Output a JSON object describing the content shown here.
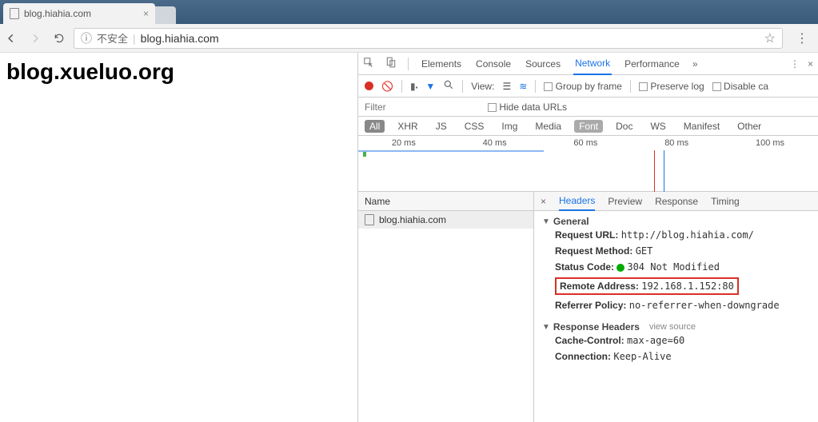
{
  "browser": {
    "tab_title": "blog.hiahia.com",
    "insecure_label": "不安全",
    "url_display": "blog.hiahia.com"
  },
  "page": {
    "heading": "blog.xueluo.org"
  },
  "devtools": {
    "tabs": [
      "Elements",
      "Console",
      "Sources",
      "Network",
      "Performance"
    ],
    "active_tab": "Network",
    "toolbar": {
      "view_label": "View:",
      "group_label": "Group by frame",
      "preserve_label": "Preserve log",
      "disable_label": "Disable ca"
    },
    "filter": {
      "placeholder": "Filter",
      "hide_urls_label": "Hide data URLs"
    },
    "types": [
      "All",
      "XHR",
      "JS",
      "CSS",
      "Img",
      "Media",
      "Font",
      "Doc",
      "WS",
      "Manifest",
      "Other"
    ],
    "timeline": [
      "20 ms",
      "40 ms",
      "60 ms",
      "80 ms",
      "100 ms"
    ],
    "list": {
      "header": "Name",
      "items": [
        "blog.hiahia.com"
      ]
    },
    "detail_tabs": [
      "Headers",
      "Preview",
      "Response",
      "Timing"
    ],
    "general": {
      "title": "General",
      "request_url_label": "Request URL:",
      "request_url": "http://blog.hiahia.com/",
      "method_label": "Request Method:",
      "method": "GET",
      "status_label": "Status Code:",
      "status": "304 Not Modified",
      "remote_label": "Remote Address:",
      "remote": "192.168.1.152:80",
      "referrer_label": "Referrer Policy:",
      "referrer": "no-referrer-when-downgrade"
    },
    "response_headers": {
      "title": "Response Headers",
      "view_source": "view source",
      "cache_label": "Cache-Control:",
      "cache": "max-age=60",
      "conn_label": "Connection:",
      "conn": "Keep-Alive"
    }
  }
}
